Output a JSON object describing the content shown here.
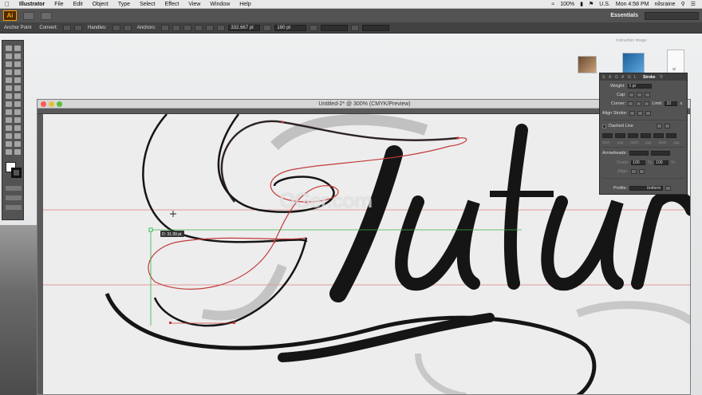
{
  "menubar": {
    "app_name": "Illustrator",
    "items": [
      "File",
      "Edit",
      "Object",
      "Type",
      "Select",
      "Effect",
      "View",
      "Window",
      "Help"
    ],
    "battery": "100%",
    "clock": "Mon 4:58 PM",
    "user": "nilsraine",
    "locale": "U.S."
  },
  "appbar": {
    "logo": "Ai",
    "workspace": "Essentials"
  },
  "controlbar": {
    "tool_label": "Anchor Point",
    "convert_label": "Convert:",
    "handles_label": "Handles:",
    "anchors_label": "Anchors:",
    "x_value": "332.667 pt",
    "y_value": "180 pt"
  },
  "document": {
    "title": "Untitled-2* @ 300% (CMYK/Preview)",
    "measure_tip": "D: 31.99 pt"
  },
  "watermark": "OGer.com",
  "desktop_label": "Instruction Image",
  "desktop_file": "ai",
  "stroke_panel": {
    "tabs": [
      "S",
      "A",
      "G",
      "A",
      "G",
      "L"
    ],
    "active_tab": "Stroke",
    "tab_after": "Tr",
    "weight_label": "Weight:",
    "weight_value": "1 pt",
    "cap_label": "Cap:",
    "corner_label": "Corner:",
    "limit_label": "Limit:",
    "limit_value": "10",
    "limit_unit": "x",
    "align_label": "Align Stroke:",
    "dashed_label": "Dashed Line",
    "dash_labels": [
      "dash",
      "gap",
      "dash",
      "gap",
      "dash",
      "gap"
    ],
    "arrowheads_label": "Arrowheads:",
    "scale_label": "Scale:",
    "scale_value_1": "100",
    "scale_value_2": "100",
    "scale_unit": "%",
    "align_arrow_label": "Align:",
    "profile_label": "Profile:",
    "profile_value": "Uniform"
  },
  "colors": {
    "accent_orange": "#ff9a00",
    "path_red": "#c23a3a",
    "guide_green": "#33b54a",
    "ink": "#151515"
  }
}
